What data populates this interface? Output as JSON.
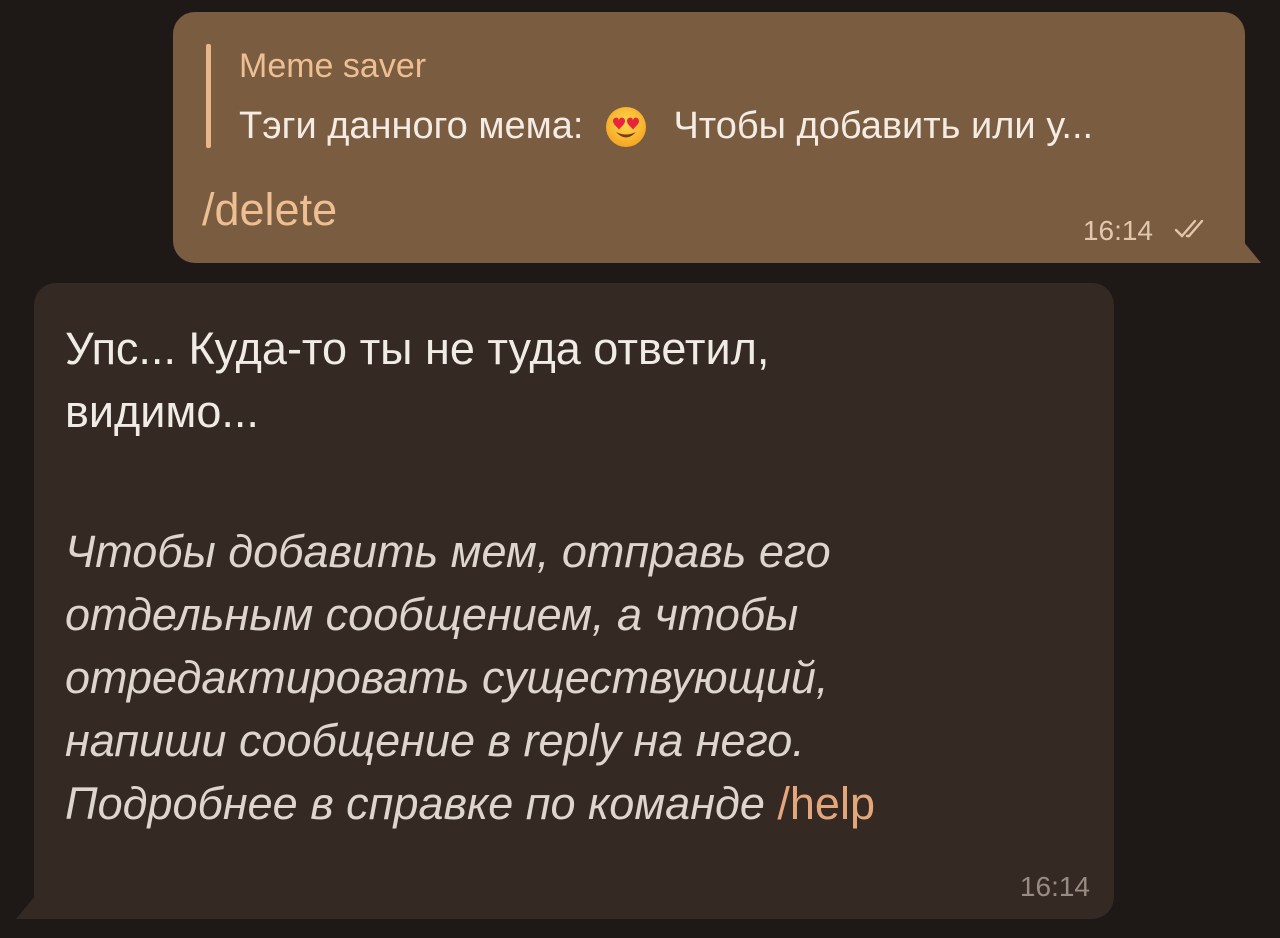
{
  "outgoing_message": {
    "reply_author": "Meme saver",
    "reply_text_before_emoji": "Тэги данного мема:",
    "reply_emoji": "smiling-face-with-heart-eyes",
    "reply_text_after_emoji": "Чтобы добавить или у...",
    "command": "/delete",
    "time": "16:14",
    "status": "read",
    "bubble_color": "#7a5c40",
    "accent_color": "#edbf92"
  },
  "incoming_message": {
    "line1": "Упс... Куда-то ты не туда ответил,",
    "line2": "видимо...",
    "italic_lines": [
      "Чтобы добавить мем, отправь его",
      "отдельным сообщением, а чтобы",
      "отредактировать существующий,",
      "напиши сообщение в reply на него.",
      "Подробнее в справке по команде"
    ],
    "help_command": "/help",
    "time": "16:14",
    "bubble_color": "#342923",
    "link_color": "#e4a77c"
  }
}
